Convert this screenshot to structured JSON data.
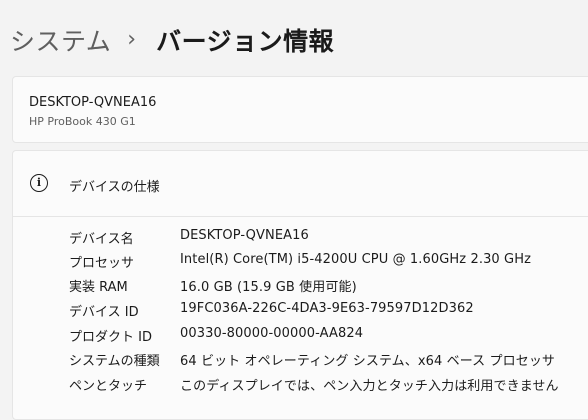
{
  "breadcrumb": {
    "parent": "システム",
    "separator": "›",
    "current": "バージョン情報"
  },
  "device": {
    "name": "DESKTOP-QVNEA16",
    "model": "HP ProBook 430 G1"
  },
  "spec": {
    "icon": "info-icon",
    "title": "デバイスの仕様",
    "rows": [
      {
        "label": "デバイス名",
        "value": "DESKTOP-QVNEA16"
      },
      {
        "label": "プロセッサ",
        "value": "Intel(R) Core(TM) i5-4200U CPU @ 1.60GHz   2.30 GHz"
      },
      {
        "label": "実装 RAM",
        "value": "16.0 GB (15.9 GB 使用可能)"
      },
      {
        "label": "デバイス ID",
        "value": "19FC036A-226C-4DA3-9E63-79597D12D362"
      },
      {
        "label": "プロダクト ID",
        "value": "00330-80000-00000-AA824"
      },
      {
        "label": "システムの種類",
        "value": "64 ビット オペレーティング システム、x64 ベース プロセッサ"
      },
      {
        "label": "ペンとタッチ",
        "value": "このディスプレイでは、ペン入力とタッチ入力は利用できません"
      }
    ]
  }
}
